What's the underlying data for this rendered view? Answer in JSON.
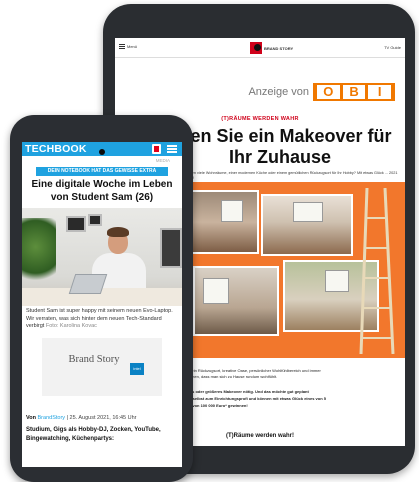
{
  "tablet": {
    "menu_label": "Menü",
    "logo_text": "BRAND STORY",
    "right_label": "TV Guide",
    "ad_label": "Anzeige von",
    "obi_letters": [
      "O",
      "B",
      "I"
    ],
    "kicker": "(T)RÄUME WERDEN WAHR",
    "headline": "nnen Sie ein Makeover für Ihr Zuhause",
    "intro": "Sie kennen viele Wohnräume, einer modernen Küche oder einem gemütlichen Rückzugsort für Ihr Hobby? Mit etwas Glück ... 2021 gewinnen!",
    "body": [
      "Sie kennen viele sein Rückzugsort, kreative Oase, persönlicher Wohlfühlbereich und immer",
      "Zuhause verwirklichen, dass man sich zu Hause rundum wohlfühlt.",
      "",
      "achmal ein kleines oder größeres Makeover nötig. Und das möchte gut geplant",
      "r App werden Sie selbst zum Einrichtungsprofi und können mit etwas Glück eines von 5",
      "n im Gesamtwert von 100 000 Euro* gewinnen!"
    ],
    "subheading": "(T)Räume werden wahr!"
  },
  "phone": {
    "logo": "TECHBOOK",
    "category": "MEDIA",
    "badge": "DEIN NOTEBOOK HAT DAS GEWISSE EXTRA",
    "title": "Eine digitale Woche im Leben von Student Sam (26)",
    "caption": "Student Sam ist super happy mit seinem neuen Evo-Laptop. Wir verraten, was sich hinter dem neuen Tech-Standard verbirgt",
    "caption_credit": "Foto: Karolina Kovac",
    "brand_story": "Brand Story",
    "intel": "intel",
    "byline_prefix": "Von",
    "byline_author": "BrandStory",
    "byline_date": "| 25. August 2021, 16:45 Uhr",
    "body": "Studium, Gigs als Hobby-DJ, Zocken, YouTube, Bingewatching, Küchenpartys:"
  },
  "colors": {
    "techbook_blue": "#1fa2e0",
    "obi_orange": "#f07800",
    "kicker_red": "#d0021b",
    "device_frame": "#2b2e33"
  }
}
